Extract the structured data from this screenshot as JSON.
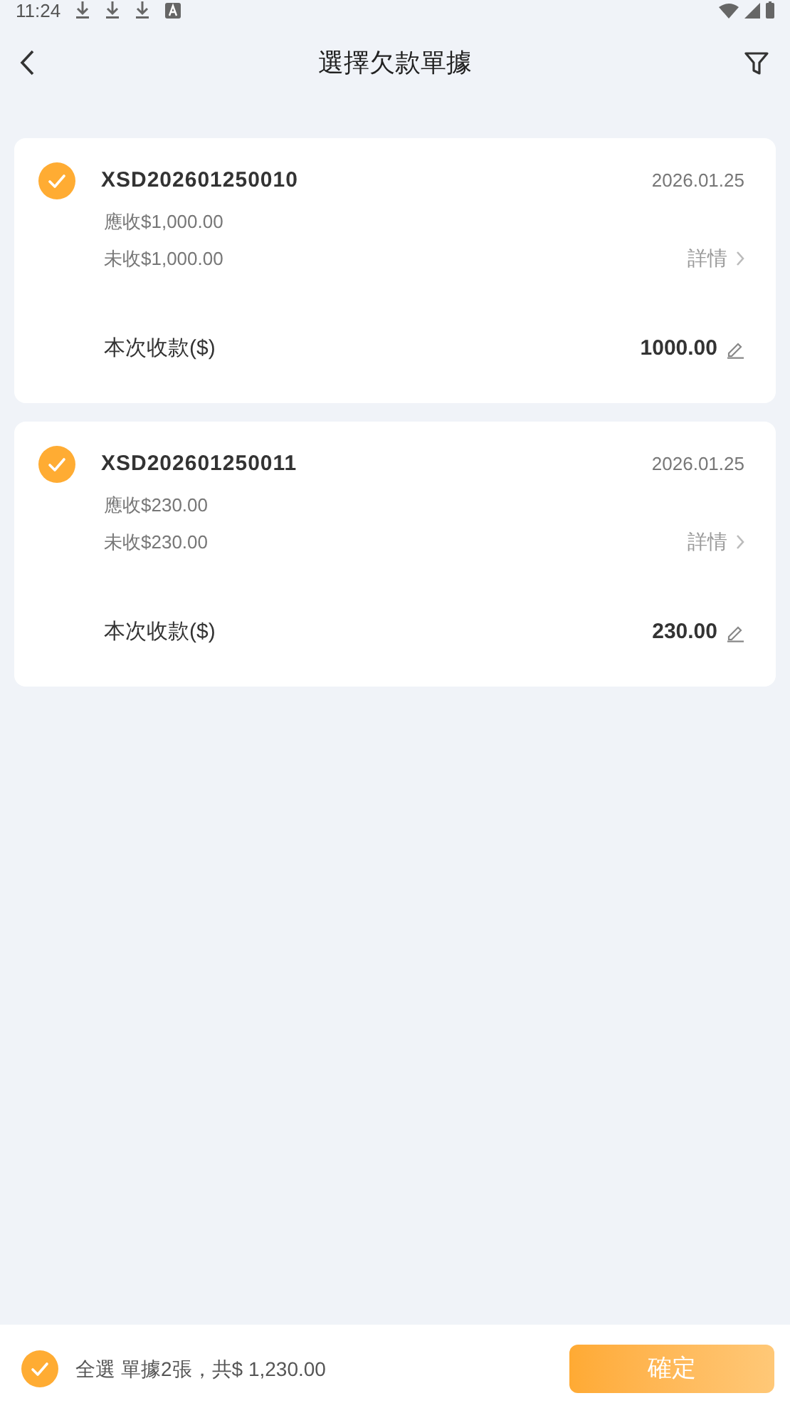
{
  "status_bar": {
    "time": "11:24"
  },
  "header": {
    "title": "選擇欠款單據"
  },
  "invoices": [
    {
      "number": "XSD202601250010",
      "date": "2026.01.25",
      "receivable": "應收$1,000.00",
      "unpaid": "未收$1,000.00",
      "details": "詳情",
      "payment_label": "本次收款($)",
      "payment": "1000.00",
      "selected": true
    },
    {
      "number": "XSD202601250011",
      "date": "2026.01.25",
      "receivable": "應收$230.00",
      "unpaid": "未收$230.00",
      "details": "詳情",
      "payment_label": "本次收款($)",
      "payment": "230.00",
      "selected": true
    }
  ],
  "footer": {
    "select_all": {
      "label": "全選",
      "selected": true
    },
    "summary": "單據2張，共$ 1,230.00",
    "confirm": "確定"
  }
}
